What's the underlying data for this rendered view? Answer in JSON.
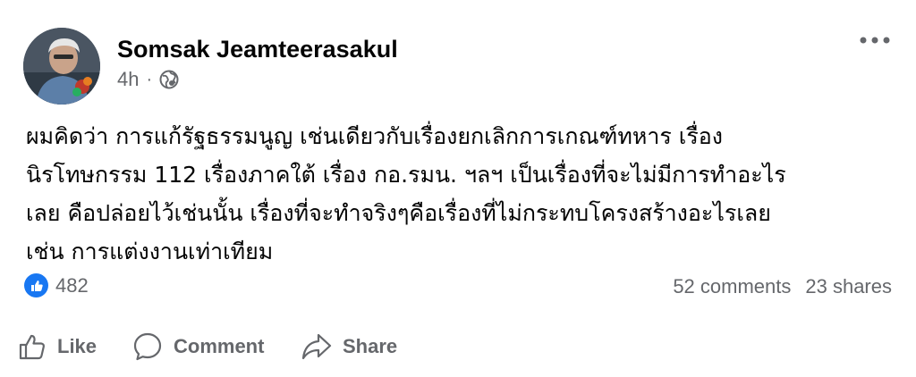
{
  "author": {
    "name": "Somsak Jeamteerasakul"
  },
  "meta": {
    "time": "4h",
    "separator": "·",
    "privacy_icon": "globe-icon"
  },
  "post": {
    "lines": [
      "ผมคิดว่า การแก้รัฐธรรมนูญ เช่นเดียวกับเรื่องยกเลิกการเกณฑ์ทหาร เรื่อง",
      "นิรโทษกรรม 112 เรื่องภาคใต้ เรื่อง กอ.รมน. ฯลฯ เป็นเรื่องที่จะไม่มีการทำอะไร",
      "เลย คือปล่อยไว้เช่นนั้น เรื่องที่จะทำจริงๆคือเรื่องที่ไม่กระทบโครงสร้างอะไรเลย",
      "เช่น การแต่งงานเท่าเทียม"
    ]
  },
  "reactions": {
    "count": "482",
    "icon": "like-reaction-icon"
  },
  "stats": {
    "comments": "52 comments",
    "shares": "23 shares"
  },
  "actions": {
    "like": "Like",
    "comment": "Comment",
    "share": "Share"
  },
  "colors": {
    "accent": "#1877f2",
    "secondary_text": "#65676b",
    "primary_text": "#050505"
  }
}
